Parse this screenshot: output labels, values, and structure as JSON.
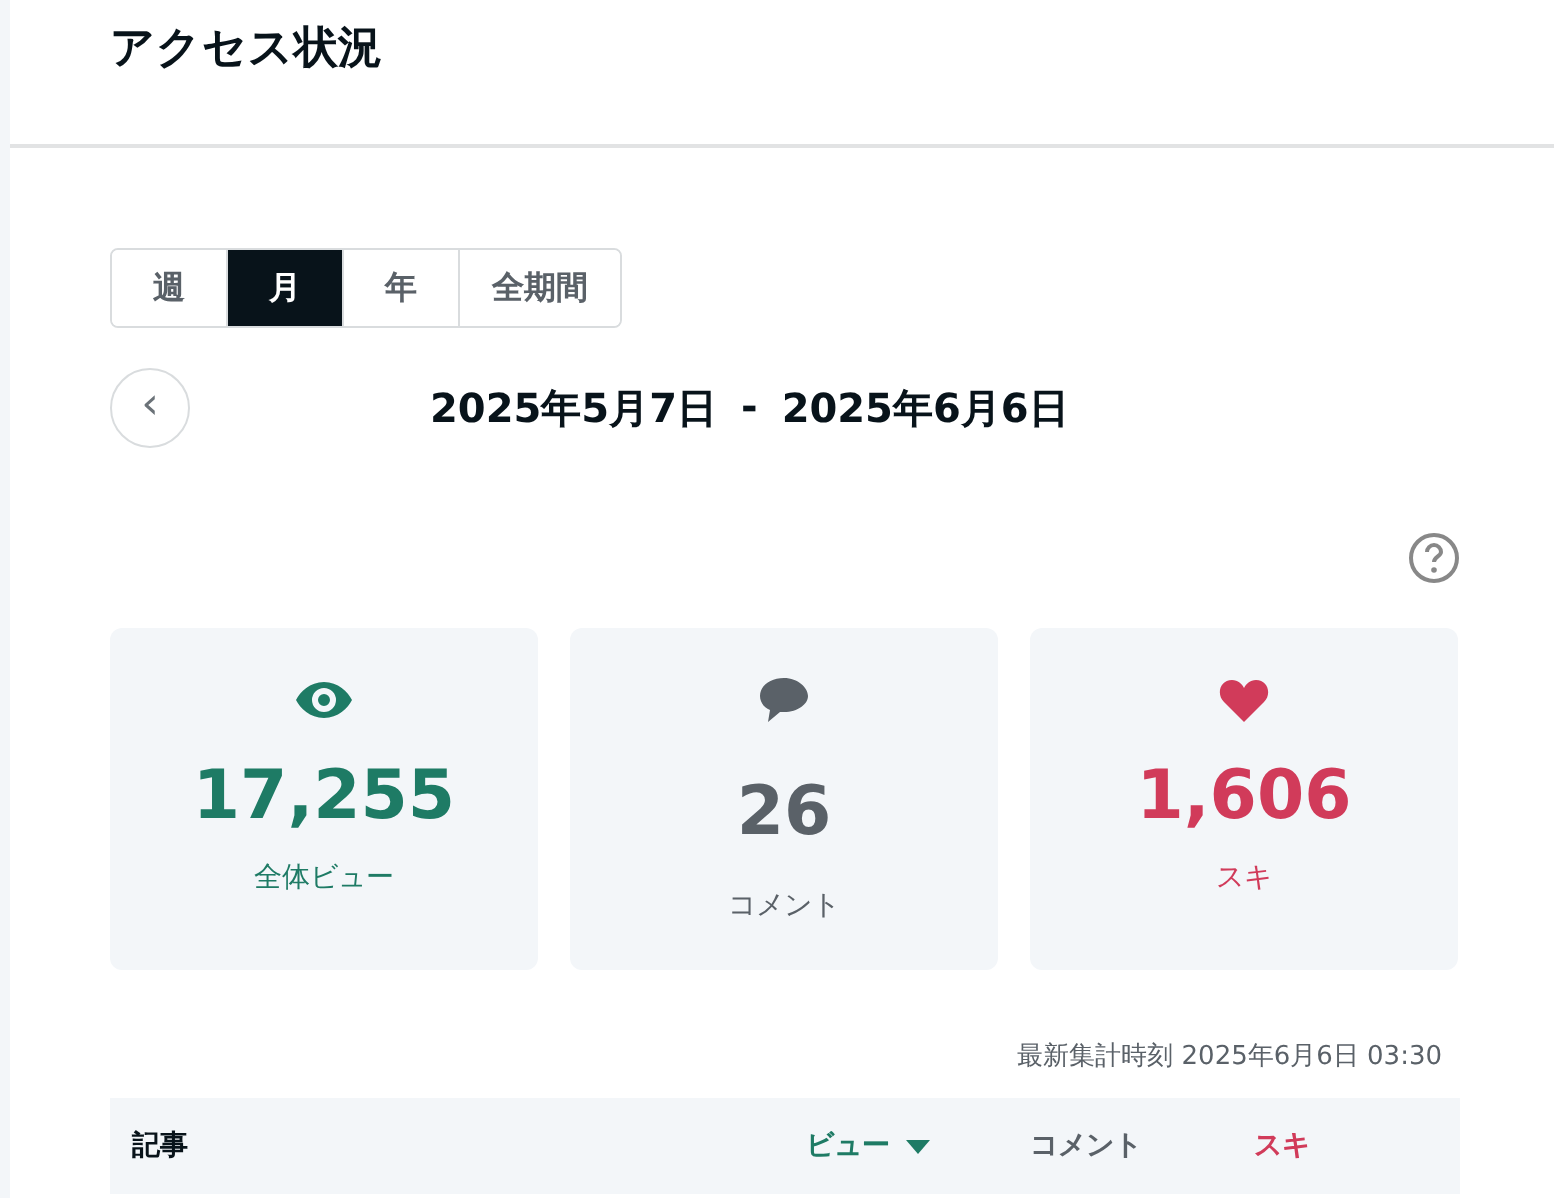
{
  "page_title": "アクセス状況",
  "period_tabs": [
    {
      "label": "週",
      "selected": false
    },
    {
      "label": "月",
      "selected": true
    },
    {
      "label": "年",
      "selected": false
    },
    {
      "label": "全期間",
      "selected": false
    }
  ],
  "date_range": {
    "prev_button": "‹",
    "start": "2025年5月7日",
    "separator": "-",
    "end": "2025年6月6日"
  },
  "stats": [
    {
      "kind": "view",
      "color": "#1e7b65",
      "value": "17,255",
      "label": "全体ビュー"
    },
    {
      "kind": "comment",
      "color": "#5a6168",
      "value": "26",
      "label": "コメント"
    },
    {
      "kind": "like",
      "color": "#d13b5a",
      "value": "1,606",
      "label": "スキ"
    }
  ],
  "updated": "最新集計時刻 2025年6月6日 03:30",
  "table": {
    "columns": [
      {
        "label": "記事",
        "color": "#08131a",
        "sorted": false
      },
      {
        "label": "ビュー",
        "color": "#1e7b65",
        "sorted": true
      },
      {
        "label": "コメント",
        "color": "#5a6168",
        "sorted": false
      },
      {
        "label": "スキ",
        "color": "#d13b5a",
        "sorted": false
      }
    ]
  }
}
